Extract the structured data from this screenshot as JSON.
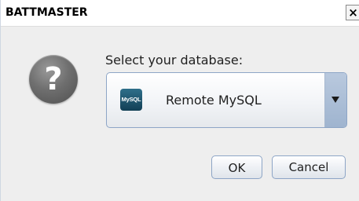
{
  "window": {
    "title": "BATTMASTER",
    "close_glyph": "✕"
  },
  "dialog": {
    "icon": "question-icon",
    "icon_glyph": "?",
    "prompt": "Select your database:",
    "database_select": {
      "selected_value": "Remote MySQL",
      "selected_icon": "mysql-icon",
      "selected_icon_text": "MySQL"
    },
    "ok_label": "OK",
    "cancel_label": "Cancel"
  },
  "colors": {
    "dialog_background": "#eeeeee",
    "title_bar_background": "#ffffff",
    "control_border": "#8da5c6",
    "combo_arrow_background": "#a9bdd6",
    "question_icon": "#6f6f6f",
    "mysql_icon": "#1d5068"
  }
}
